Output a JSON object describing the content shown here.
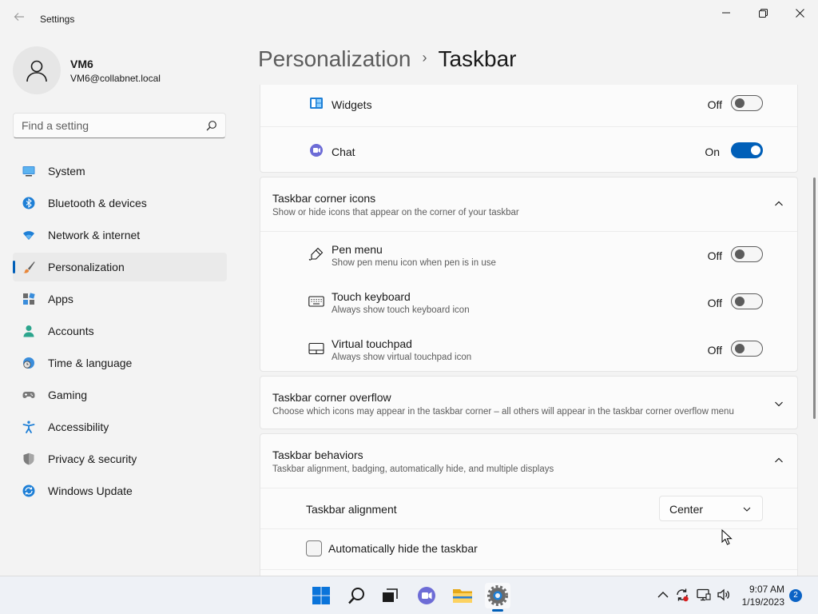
{
  "window": {
    "title": "Settings"
  },
  "user": {
    "name": "VM6",
    "email": "VM6@collabnet.local"
  },
  "search": {
    "placeholder": "Find a setting"
  },
  "sidebar": {
    "items": [
      {
        "label": "System",
        "icon": "monitor-icon"
      },
      {
        "label": "Bluetooth & devices",
        "icon": "bluetooth-icon"
      },
      {
        "label": "Network & internet",
        "icon": "wifi-icon"
      },
      {
        "label": "Personalization",
        "icon": "paintbrush-icon",
        "selected": true
      },
      {
        "label": "Apps",
        "icon": "apps-icon"
      },
      {
        "label": "Accounts",
        "icon": "person-icon"
      },
      {
        "label": "Time & language",
        "icon": "globe-clock-icon"
      },
      {
        "label": "Gaming",
        "icon": "gamepad-icon"
      },
      {
        "label": "Accessibility",
        "icon": "accessibility-icon"
      },
      {
        "label": "Privacy & security",
        "icon": "shield-icon"
      },
      {
        "label": "Windows Update",
        "icon": "update-icon"
      }
    ]
  },
  "header": {
    "parent": "Personalization",
    "separator": "›",
    "current": "Taskbar"
  },
  "taskbar_items": {
    "widgets": {
      "title": "Widgets",
      "state": "Off"
    },
    "chat": {
      "title": "Chat",
      "state": "On"
    }
  },
  "corner_icons": {
    "title": "Taskbar corner icons",
    "subtitle": "Show or hide icons that appear on the corner of your taskbar",
    "items": [
      {
        "title": "Pen menu",
        "subtitle": "Show pen menu icon when pen is in use",
        "state": "Off"
      },
      {
        "title": "Touch keyboard",
        "subtitle": "Always show touch keyboard icon",
        "state": "Off"
      },
      {
        "title": "Virtual touchpad",
        "subtitle": "Always show virtual touchpad icon",
        "state": "Off"
      }
    ]
  },
  "corner_overflow": {
    "title": "Taskbar corner overflow",
    "subtitle": "Choose which icons may appear in the taskbar corner – all others will appear in the taskbar corner overflow menu"
  },
  "behaviors": {
    "title": "Taskbar behaviors",
    "subtitle": "Taskbar alignment, badging, automatically hide, and multiple displays",
    "alignment_label": "Taskbar alignment",
    "alignment_value": "Center",
    "autohide_label": "Automatically hide the taskbar"
  },
  "system_taskbar": {
    "time": "9:07 AM",
    "date": "1/19/2023",
    "notification_count": "2"
  },
  "colors": {
    "accent": "#005fb8"
  }
}
